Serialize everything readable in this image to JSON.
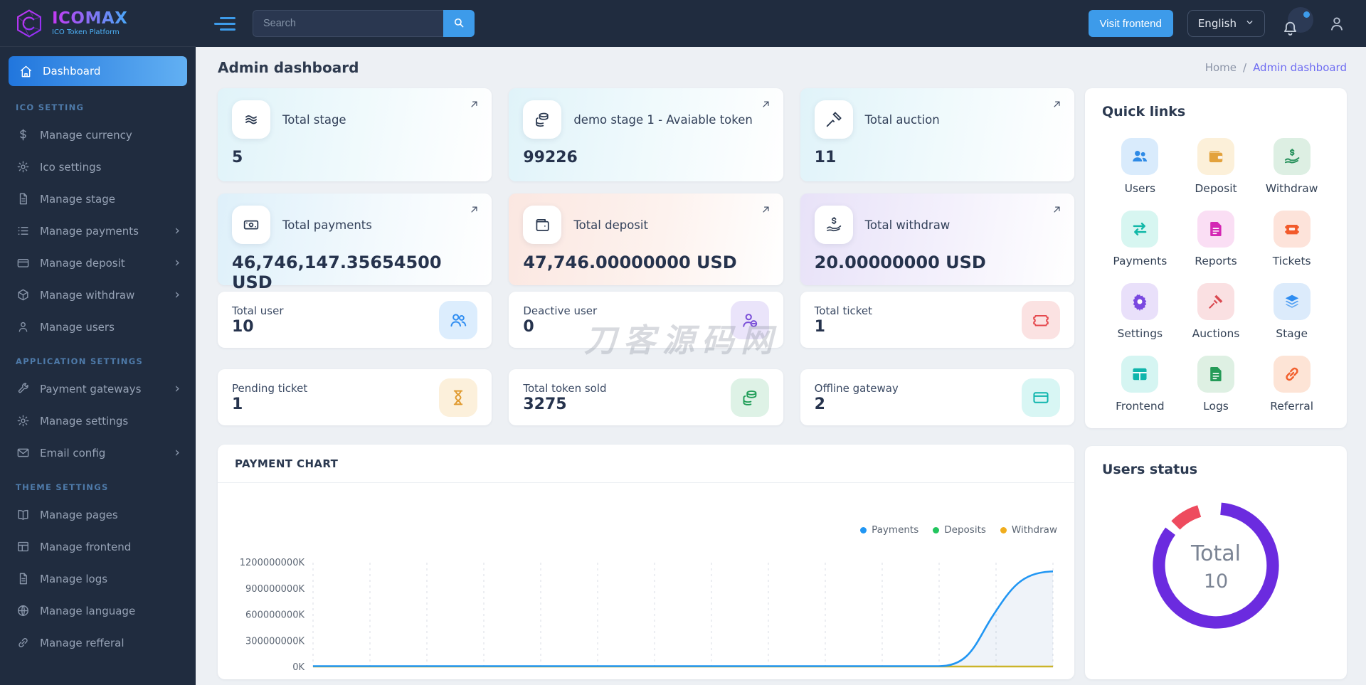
{
  "brand": {
    "name": "ICOMAX",
    "tagline": "ICO Token Platform"
  },
  "topbar": {
    "search_placeholder": "Search",
    "visit_frontend_label": "Visit frontend",
    "language": "English"
  },
  "page": {
    "title": "Admin dashboard",
    "breadcrumb_home": "Home",
    "breadcrumb_sep": "/",
    "breadcrumb_current": "Admin dashboard"
  },
  "sidebar": {
    "sections": [
      {
        "heading": "",
        "items": [
          {
            "label": "Dashboard",
            "icon": "home",
            "active": true
          }
        ]
      },
      {
        "heading": "ICO SETTING",
        "items": [
          {
            "label": "Manage currency",
            "icon": "dollar"
          },
          {
            "label": "Ico settings",
            "icon": "gear"
          },
          {
            "label": "Manage stage",
            "icon": "file"
          },
          {
            "label": "Manage payments",
            "icon": "list",
            "chevron": true
          },
          {
            "label": "Manage deposit",
            "icon": "credit-card",
            "chevron": true
          },
          {
            "label": "Manage withdraw",
            "icon": "package",
            "chevron": true
          },
          {
            "label": "Manage users",
            "icon": "user"
          }
        ]
      },
      {
        "heading": "APPLICATION SETTINGS",
        "items": [
          {
            "label": "Payment gateways",
            "icon": "wrench",
            "chevron": true
          },
          {
            "label": "Manage settings",
            "icon": "gear"
          },
          {
            "label": "Email config",
            "icon": "envelope",
            "chevron": true
          }
        ]
      },
      {
        "heading": "THEME SETTINGS",
        "items": [
          {
            "label": "Manage pages",
            "icon": "book-open"
          },
          {
            "label": "Manage frontend",
            "icon": "layout"
          },
          {
            "label": "Manage logs",
            "icon": "file"
          },
          {
            "label": "Manage language",
            "icon": "globe"
          },
          {
            "label": "Manage refferal",
            "icon": "link"
          }
        ]
      }
    ]
  },
  "cards_row1": [
    {
      "title": "Total stage",
      "value": "5",
      "icon": "layers-wave"
    },
    {
      "title": "demo stage 1 - Avaiable token",
      "value": "99226",
      "icon": "coins"
    },
    {
      "title": "Total auction",
      "value": "11",
      "icon": "gavel"
    }
  ],
  "cards_row2": [
    {
      "title": "Total payments",
      "value": "46,746,147.35654500 USD",
      "icon": "cash"
    },
    {
      "title": "Total deposit",
      "value": "47,746.00000000 USD",
      "icon": "wallet"
    },
    {
      "title": "Total withdraw",
      "value": "20.00000000 USD",
      "icon": "hand-dollar"
    }
  ],
  "cards_small": [
    {
      "title": "Total user",
      "value": "10",
      "icon": "users"
    },
    {
      "title": "Deactive user",
      "value": "0",
      "icon": "user-minus"
    },
    {
      "title": "Total ticket",
      "value": "1",
      "icon": "ticket"
    },
    {
      "title": "Pending ticket",
      "value": "1",
      "icon": "hourglass"
    },
    {
      "title": "Total token sold",
      "value": "3275",
      "icon": "coins"
    },
    {
      "title": "Offline gateway",
      "value": "2",
      "icon": "credit-card"
    }
  ],
  "quick_links": {
    "title": "Quick links",
    "items": [
      {
        "label": "Users",
        "icon": "users",
        "fg": "#2e8ae6",
        "bg": "#d9ebfc"
      },
      {
        "label": "Deposit",
        "icon": "wallet",
        "fg": "#e3a23c",
        "bg": "#fcf0d9"
      },
      {
        "label": "Withdraw",
        "icon": "hand-dollar",
        "fg": "#27915c",
        "bg": "#ddefe3"
      },
      {
        "label": "Payments",
        "icon": "transfer-arrows",
        "fg": "#12b8a8",
        "bg": "#d7f6f1"
      },
      {
        "label": "Reports",
        "icon": "report-file",
        "fg": "#d427b4",
        "bg": "#fadef4"
      },
      {
        "label": "Tickets",
        "icon": "ticket",
        "fg": "#f25a2b",
        "bg": "#fde3da"
      },
      {
        "label": "Settings",
        "icon": "gear",
        "fg": "#7a49e0",
        "bg": "#e9e0fa"
      },
      {
        "label": "Auctions",
        "icon": "gavel",
        "fg": "#da4a52",
        "bg": "#fae0e2"
      },
      {
        "label": "Stage",
        "icon": "layers",
        "fg": "#2f8df1",
        "bg": "#dcebfb"
      },
      {
        "label": "Frontend",
        "icon": "table",
        "fg": "#10b5ac",
        "bg": "#d5f5f2"
      },
      {
        "label": "Logs",
        "icon": "log-file",
        "fg": "#259b58",
        "bg": "#def0e3"
      },
      {
        "label": "Referral",
        "icon": "link",
        "fg": "#f2602e",
        "bg": "#fde4d6"
      }
    ]
  },
  "payment_chart": {
    "title": "PAYMENT CHART",
    "type": "line",
    "legend": [
      "Payments",
      "Deposits",
      "Withdraw"
    ],
    "yticks": [
      "1200000000K",
      "900000000K",
      "600000000K",
      "300000000K",
      "0K"
    ],
    "ylim_K": [
      0,
      1200000000
    ],
    "grid": "vertical-dashed",
    "legend_position": "top-right",
    "series": [
      {
        "name": "Payments",
        "color": "#2196f3",
        "approx_values_K": [
          0,
          0,
          0,
          0,
          0,
          0,
          0,
          0,
          0,
          0,
          0,
          0,
          0,
          1100000000
        ]
      },
      {
        "name": "Deposits",
        "color": "#22c55e",
        "approx_values_K": [
          0,
          0,
          0,
          0,
          0,
          0,
          0,
          0,
          0,
          0,
          0,
          0,
          0,
          0
        ]
      },
      {
        "name": "Withdraw",
        "color": "#f0ad1d",
        "approx_values_K": [
          0,
          0,
          0,
          0,
          0,
          0,
          0,
          0,
          0,
          0,
          0,
          0,
          0,
          0
        ]
      }
    ]
  },
  "users_status": {
    "title": "Users status",
    "center_label": "Total",
    "center_value": "10",
    "segments": [
      {
        "color": "#6b2bdf",
        "fraction": 0.9
      },
      {
        "color": "#ee4b5e",
        "fraction": 0.1
      }
    ]
  },
  "watermark": "刀客源码网",
  "colors": {
    "accent_blue": "#3d9bea",
    "sidebar_bg": "#202c3f",
    "content_bg": "#edf0f4",
    "breadcrumb_active": "#6e6cf2",
    "active_item_gradient": [
      "#2176dd",
      "#62b0f3"
    ],
    "donut_purple": "#6b2bdf",
    "donut_red": "#ee4b5e"
  }
}
